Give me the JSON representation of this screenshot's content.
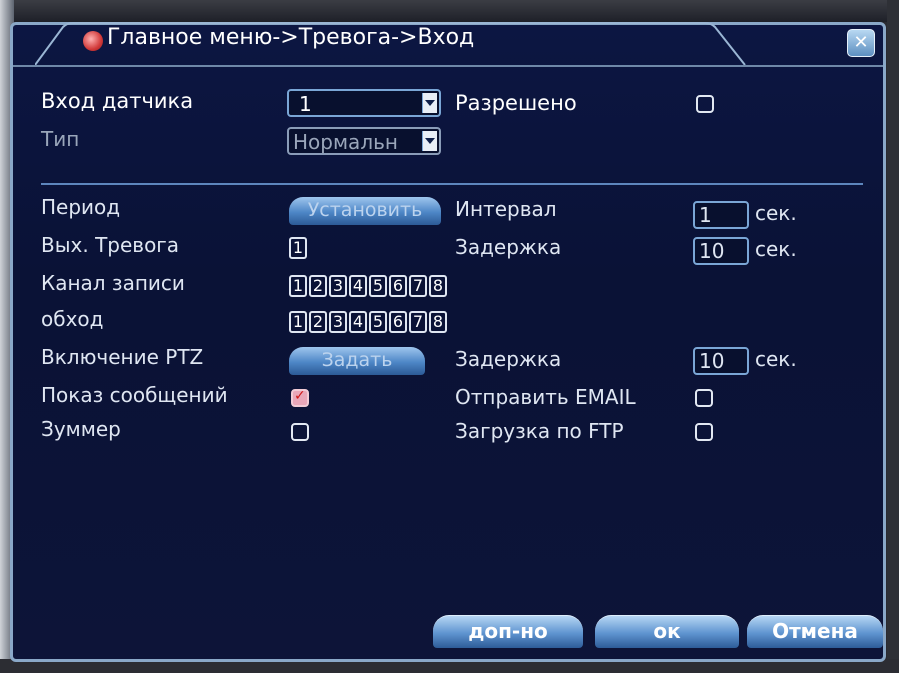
{
  "window": {
    "title": "Главное меню->Тревога->Вход",
    "close_icon": "close-icon"
  },
  "sensor": {
    "label": "Вход датчика",
    "value": "1",
    "enabled_label": "Разрешено",
    "enabled": false
  },
  "type": {
    "label": "Тип",
    "value": "Нормальн"
  },
  "period": {
    "label": "Период",
    "button": "Установить"
  },
  "interval": {
    "label": "Интервал",
    "value": "1",
    "unit": "сек."
  },
  "alarm_out": {
    "label": "Вых. Тревога",
    "channels": [
      "1"
    ]
  },
  "delay1": {
    "label": "Задержка",
    "value": "10",
    "unit": "сек."
  },
  "record_channel": {
    "label": "Канал записи",
    "channels": [
      "1",
      "2",
      "3",
      "4",
      "5",
      "6",
      "7",
      "8"
    ]
  },
  "tour": {
    "label": "обход",
    "channels": [
      "1",
      "2",
      "3",
      "4",
      "5",
      "6",
      "7",
      "8"
    ]
  },
  "ptz": {
    "label": "Включение PTZ",
    "button": "Задать"
  },
  "delay2": {
    "label": "Задержка",
    "value": "10",
    "unit": "сек."
  },
  "show_message": {
    "label": "Показ сообщений",
    "checked": true
  },
  "send_email": {
    "label": "Отправить EMAIL",
    "checked": false
  },
  "buzzer": {
    "label": "Зуммер",
    "checked": false
  },
  "ftp_upload": {
    "label": "Загрузка по FTP",
    "checked": false
  },
  "footer": {
    "advanced": "доп-но",
    "ok": "ок",
    "cancel": "Отмена"
  }
}
